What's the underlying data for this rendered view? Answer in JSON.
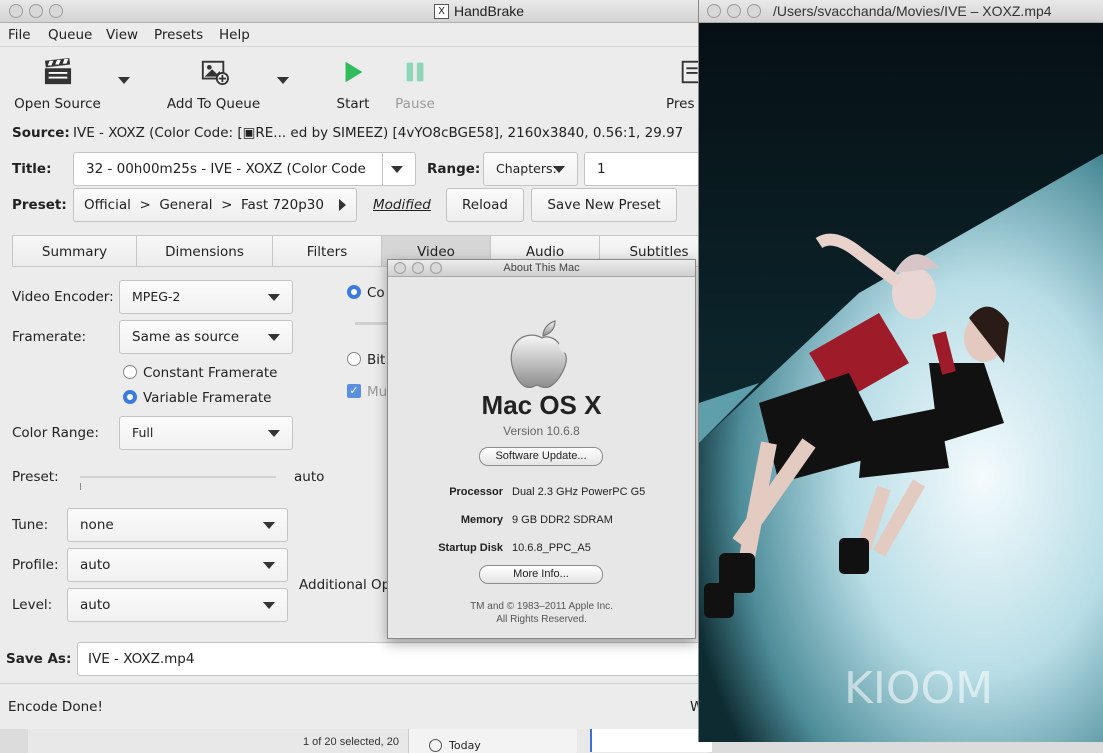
{
  "handbrake": {
    "window_title": "HandBrake",
    "menu": [
      "File",
      "Queue",
      "View",
      "Presets",
      "Help"
    ],
    "toolbar": {
      "open_source": "Open Source",
      "add_to_queue": "Add To Queue",
      "start": "Start",
      "pause": "Pause",
      "presets": "Pres"
    },
    "source_label": "Source:",
    "source_value": "IVE - XOXZ (Color Code:  [▣RE... ed by SIMEEZ) [4vYO8cBGE58], 2160x3840, 0.56:1, 29.97",
    "title_label": "Title:",
    "title_value": "32 - 00h00m25s - IVE - XOXZ (Color Code",
    "range_label": "Range:",
    "range_mode": "Chapters:",
    "range_start": "1",
    "preset_label": "Preset:",
    "preset_path": "Official  >  General  >  Fast 720p30",
    "modified": "Modified",
    "reload": "Reload",
    "save_new_preset": "Save New Preset",
    "tabs": [
      "Summary",
      "Dimensions",
      "Filters",
      "Video",
      "Audio",
      "Subtitles"
    ],
    "active_tab": "Video",
    "video": {
      "encoder_label": "Video Encoder:",
      "encoder_value": "MPEG-2",
      "framerate_label": "Framerate:",
      "framerate_value": "Same as source",
      "constant_framerate": "Constant Framerate",
      "variable_framerate": "Variable Framerate",
      "color_range_label": "Color Range:",
      "color_range_value": "Full",
      "preset_label": "Preset:",
      "preset_value": "auto",
      "tune_label": "Tune:",
      "tune_value": "none",
      "profile_label": "Profile:",
      "profile_value": "auto",
      "level_label": "Level:",
      "level_value": "auto",
      "additional_options": "Additional Op",
      "quality_constant": "Co",
      "quality_bitrate": "Bit",
      "multipass": "Mu"
    },
    "save_as_label": "Save As:",
    "save_as_value": "IVE - XOXZ.mp4",
    "status": "Encode Done!",
    "status_right": "W"
  },
  "about_mac": {
    "window_title": "About This Mac",
    "os_name": "Mac OS X",
    "version": "Version 10.6.8",
    "software_update": "Software Update...",
    "processor_label": "Processor",
    "processor_value": "Dual 2.3 GHz PowerPC G5",
    "memory_label": "Memory",
    "memory_value": "9 GB DDR2 SDRAM",
    "startup_label": "Startup Disk",
    "startup_value": "10.6.8_PPC_A5",
    "more_info": "More Info...",
    "copyright1": "TM and © 1983–2011 Apple Inc.",
    "copyright2": "All Rights Reserved."
  },
  "player": {
    "window_title": "/Users/svacchanda/Movies/IVE – XOXZ.mp4",
    "watermark": "KIOOM"
  },
  "finder": {
    "status": "1 of 20 selected, 20",
    "sidebar_item": "Today"
  },
  "colors": {
    "start_green": "#2ebd59",
    "pause_teal": "#8fd6b8",
    "radio_blue": "#3b7be0"
  }
}
